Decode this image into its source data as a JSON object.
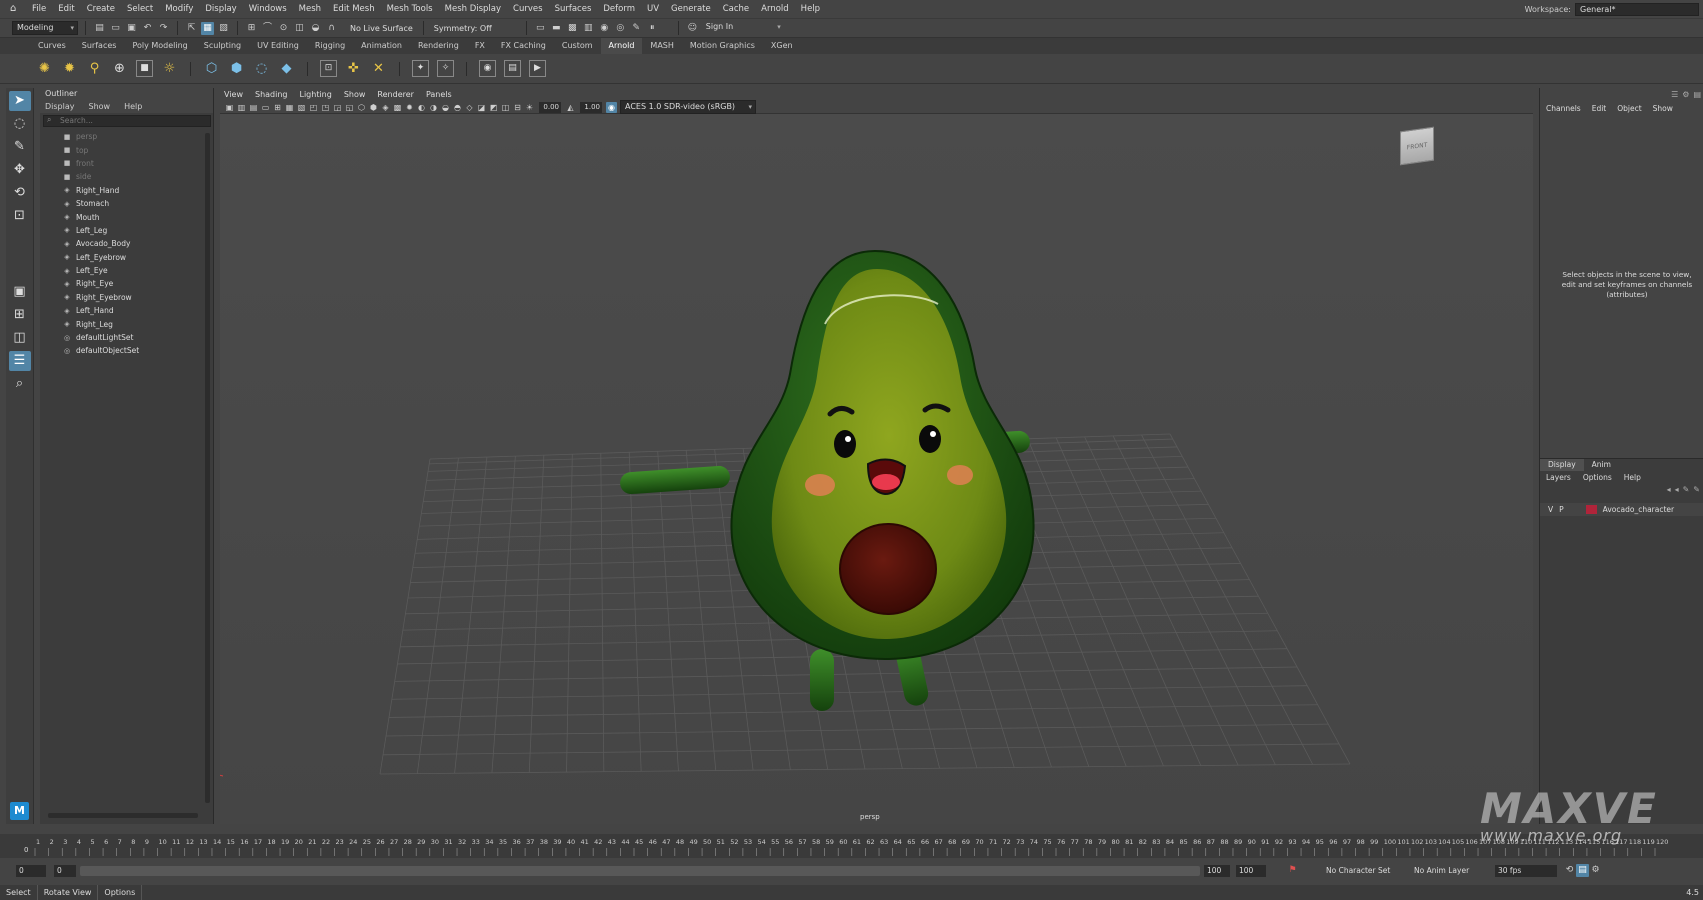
{
  "menubar": {
    "items": [
      "File",
      "Edit",
      "Create",
      "Select",
      "Modify",
      "Display",
      "Windows",
      "Mesh",
      "Edit Mesh",
      "Mesh Tools",
      "Mesh Display",
      "Curves",
      "Surfaces",
      "Deform",
      "UV",
      "Generate",
      "Cache",
      "Arnold",
      "Help"
    ],
    "workspace_label": "Workspace:",
    "workspace_value": "General*"
  },
  "statusline": {
    "mode": "Modeling",
    "live_surface": "No Live Surface",
    "symmetry": "Symmetry: Off",
    "sign_in": "Sign In"
  },
  "shelf_tabs": {
    "items": [
      "Curves",
      "Surfaces",
      "Poly Modeling",
      "Sculpting",
      "UV Editing",
      "Rigging",
      "Animation",
      "Rendering",
      "FX",
      "FX Caching",
      "Custom",
      "Arnold",
      "MASH",
      "Motion Graphics",
      "XGen"
    ],
    "active": "Arnold"
  },
  "outliner": {
    "title": "Outliner",
    "menu": [
      "Display",
      "Show",
      "Help"
    ],
    "search_placeholder": "Search...",
    "items": [
      {
        "label": "persp",
        "dim": true,
        "icon": "camera"
      },
      {
        "label": "top",
        "dim": true,
        "icon": "camera"
      },
      {
        "label": "front",
        "dim": true,
        "icon": "camera"
      },
      {
        "label": "side",
        "dim": true,
        "icon": "camera"
      },
      {
        "label": "Right_Hand",
        "dim": false,
        "icon": "mesh"
      },
      {
        "label": "Stomach",
        "dim": false,
        "icon": "mesh"
      },
      {
        "label": "Mouth",
        "dim": false,
        "icon": "mesh"
      },
      {
        "label": "Left_Leg",
        "dim": false,
        "icon": "mesh"
      },
      {
        "label": "Avocado_Body",
        "dim": false,
        "icon": "mesh"
      },
      {
        "label": "Left_Eyebrow",
        "dim": false,
        "icon": "mesh"
      },
      {
        "label": "Left_Eye",
        "dim": false,
        "icon": "mesh"
      },
      {
        "label": "Right_Eye",
        "dim": false,
        "icon": "mesh"
      },
      {
        "label": "Right_Eyebrow",
        "dim": false,
        "icon": "mesh"
      },
      {
        "label": "Left_Hand",
        "dim": false,
        "icon": "mesh"
      },
      {
        "label": "Right_Leg",
        "dim": false,
        "icon": "mesh"
      },
      {
        "label": "defaultLightSet",
        "dim": false,
        "icon": "set"
      },
      {
        "label": "defaultObjectSet",
        "dim": false,
        "icon": "set"
      }
    ]
  },
  "viewport": {
    "menu": [
      "View",
      "Shading",
      "Lighting",
      "Show",
      "Renderer",
      "Panels"
    ],
    "exposure": "0.00",
    "gamma": "1.00",
    "color_space": "ACES 1.0 SDR-video (sRGB)",
    "camera_label": "persp",
    "viewcube_label": "FRONT"
  },
  "channelbox": {
    "menu": [
      "Channels",
      "Edit",
      "Object",
      "Show"
    ],
    "message": "Select objects in the scene to view, edit and set keyframes on channels (attributes)"
  },
  "layers": {
    "tabs": [
      "Display",
      "Anim"
    ],
    "active_tab": "Display",
    "menu": [
      "Layers",
      "Options",
      "Help"
    ],
    "items": [
      {
        "v": "V",
        "p": "P",
        "name": "Avocado_character",
        "color": "#b0243a"
      }
    ]
  },
  "timeline": {
    "start": 1,
    "end": 120,
    "current_frame_label": "0"
  },
  "range": {
    "start": "0",
    "start2": "0",
    "end": "100",
    "end2": "100",
    "character_set": "No Character Set",
    "anim_layer": "No Anim Layer",
    "fps": "30 fps"
  },
  "cmdline": {
    "items": [
      "Select",
      "Rotate View",
      "Options"
    ],
    "right": "4.5"
  },
  "watermark": {
    "big": "MAXVE",
    "small": "www.maxve.org"
  }
}
